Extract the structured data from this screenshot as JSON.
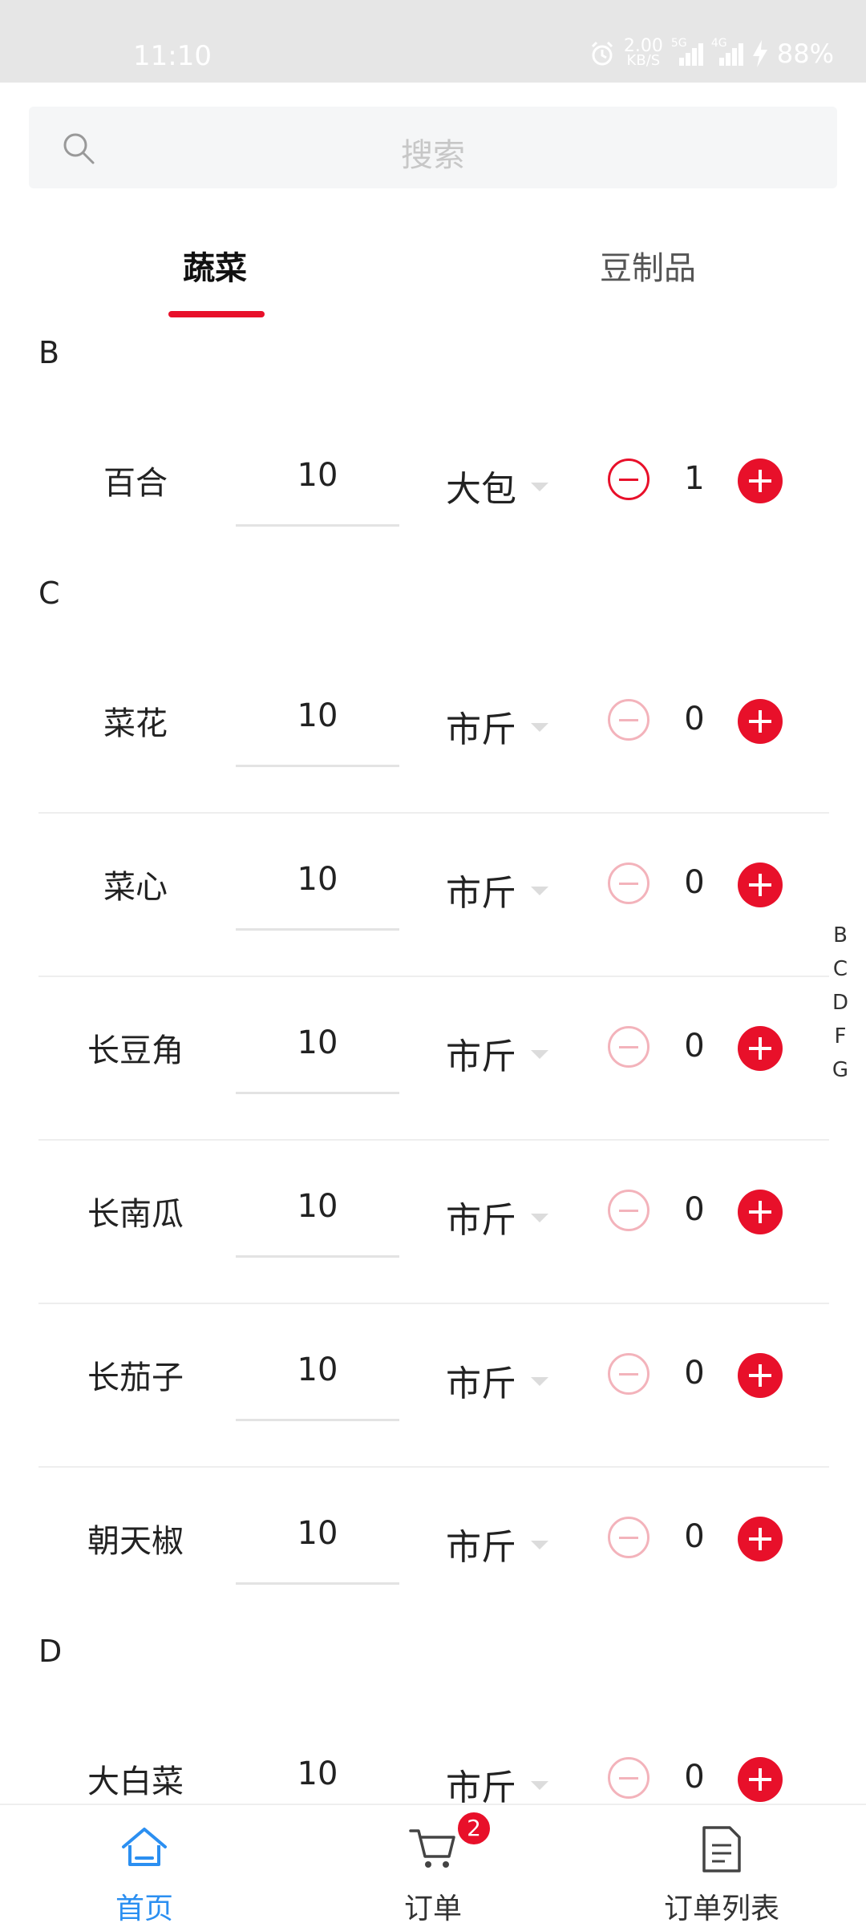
{
  "status_bar": {
    "time": "11:10",
    "net_speed": "2.00",
    "net_unit": "KB/S",
    "net_type_1": "5G",
    "net_type_2": "4G",
    "battery": "88%"
  },
  "search": {
    "placeholder": "搜索"
  },
  "tabs": [
    {
      "label": "蔬菜",
      "active": true
    },
    {
      "label": "豆制品",
      "active": false
    }
  ],
  "sections": [
    {
      "letter": "B",
      "items": [
        {
          "name": "百合",
          "qty": "10",
          "unit": "大包",
          "count": "1"
        }
      ]
    },
    {
      "letter": "C",
      "items": [
        {
          "name": "菜花",
          "qty": "10",
          "unit": "市斤",
          "count": "0"
        },
        {
          "name": "菜心",
          "qty": "10",
          "unit": "市斤",
          "count": "0"
        },
        {
          "name": "长豆角",
          "qty": "10",
          "unit": "市斤",
          "count": "0"
        },
        {
          "name": "长南瓜",
          "qty": "10",
          "unit": "市斤",
          "count": "0"
        },
        {
          "name": "长茄子",
          "qty": "10",
          "unit": "市斤",
          "count": "0"
        },
        {
          "name": "朝天椒",
          "qty": "10",
          "unit": "市斤",
          "count": "0"
        }
      ]
    },
    {
      "letter": "D",
      "items": [
        {
          "name": "大白菜",
          "qty": "10",
          "unit": "市斤",
          "count": "0"
        }
      ]
    }
  ],
  "index_letters": [
    "B",
    "C",
    "D",
    "F",
    "G"
  ],
  "bottom_nav": [
    {
      "label": "首页",
      "icon": "home-icon",
      "active": true
    },
    {
      "label": "订单",
      "icon": "cart-icon",
      "badge": "2"
    },
    {
      "label": "订单列表",
      "icon": "document-list-icon"
    }
  ],
  "colors": {
    "accent": "#e8102a",
    "active_nav": "#2b8ff1"
  }
}
